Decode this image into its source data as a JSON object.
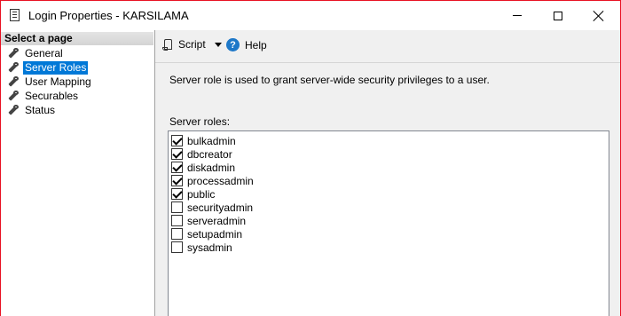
{
  "window": {
    "title": "Login Properties - KARSILAMA"
  },
  "left_panel": {
    "header": "Select a page",
    "pages": [
      {
        "label": "General",
        "selected": false
      },
      {
        "label": "Server Roles",
        "selected": true
      },
      {
        "label": "User Mapping",
        "selected": false
      },
      {
        "label": "Securables",
        "selected": false
      },
      {
        "label": "Status",
        "selected": false
      }
    ]
  },
  "toolbar": {
    "script_label": "Script",
    "help_label": "Help",
    "help_glyph": "?"
  },
  "main": {
    "description": "Server role is used to grant server-wide security privileges to a user.",
    "roles_label": "Server roles:",
    "roles": [
      {
        "name": "bulkadmin",
        "checked": true
      },
      {
        "name": "dbcreator",
        "checked": true
      },
      {
        "name": "diskadmin",
        "checked": true
      },
      {
        "name": "processadmin",
        "checked": true
      },
      {
        "name": "public",
        "checked": true
      },
      {
        "name": "securityadmin",
        "checked": false
      },
      {
        "name": "serveradmin",
        "checked": false
      },
      {
        "name": "setupadmin",
        "checked": false
      },
      {
        "name": "sysadmin",
        "checked": false
      }
    ]
  },
  "colors": {
    "selection": "#0078d7",
    "window_border": "#e81123",
    "help_icon": "#1e78c8"
  }
}
